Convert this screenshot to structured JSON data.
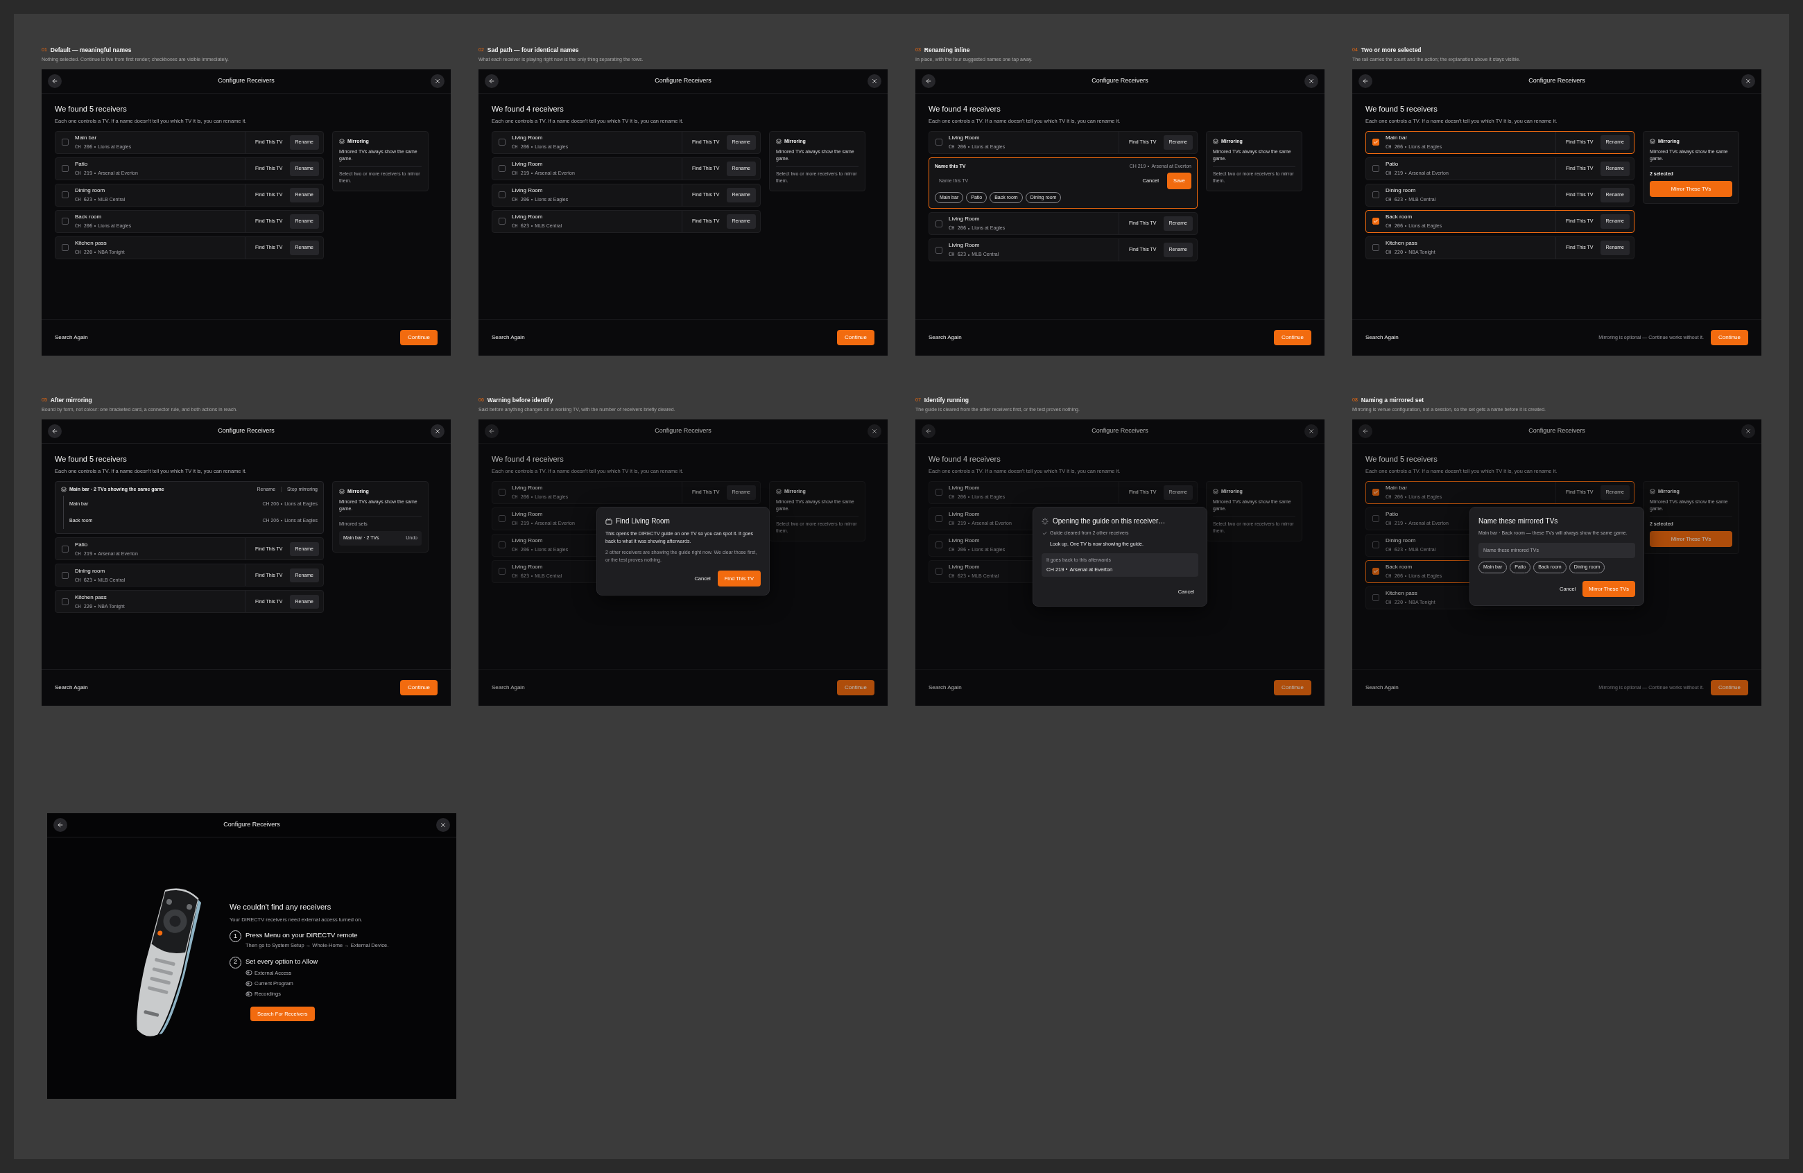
{
  "frames": [
    {
      "number": "01",
      "title": "Default — meaningful names",
      "caption": "Nothing selected. Continue is live from first render; checkboxes are visible immediately.",
      "dimmed": false,
      "screen": {
        "kind": "list",
        "title": "Configure Receivers",
        "heading": "We found 5 receivers",
        "subtext": "Each one controls a TV. If a name doesn't tell you which TV it is, you can rename it.",
        "receivers": [
          {
            "kind": "receiver",
            "name": "Main bar",
            "channel": "CH 206",
            "program": "Lions at Eagles",
            "checked": false,
            "find": "Find This TV",
            "rename": "Rename"
          },
          {
            "kind": "receiver",
            "name": "Patio",
            "channel": "CH 219",
            "program": "Arsenal at Everton",
            "checked": false,
            "find": "Find This TV",
            "rename": "Rename"
          },
          {
            "kind": "receiver",
            "name": "Dining room",
            "channel": "CH 623",
            "program": "MLB Central",
            "checked": false,
            "find": "Find This TV",
            "rename": "Rename"
          },
          {
            "kind": "receiver",
            "name": "Back room",
            "channel": "CH 206",
            "program": "Lions at Eagles",
            "checked": false,
            "find": "Find This TV",
            "rename": "Rename"
          },
          {
            "kind": "receiver",
            "name": "Kitchen pass",
            "channel": "CH 220",
            "program": "NBA Tonight",
            "checked": false,
            "find": "Find This TV",
            "rename": "Rename"
          }
        ],
        "rail": {
          "title": "Mirroring",
          "text": "Mirrored TVs always show the same game.",
          "hint": "Select two or more receivers to mirror them."
        },
        "footer": {
          "search": "Search Again",
          "continue": "Continue"
        }
      }
    },
    {
      "number": "02",
      "title": "Sad path — four identical names",
      "caption": "What each receiver is playing right now is the only thing separating the rows.",
      "dimmed": false,
      "screen": {
        "kind": "list",
        "title": "Configure Receivers",
        "heading": "We found 4 receivers",
        "subtext": "Each one controls a TV. If a name doesn't tell you which TV it is, you can rename it.",
        "receivers": [
          {
            "kind": "receiver",
            "name": "Living Room",
            "channel": "CH 206",
            "program": "Lions at Eagles",
            "checked": false,
            "find": "Find This TV",
            "rename": "Rename"
          },
          {
            "kind": "receiver",
            "name": "Living Room",
            "channel": "CH 219",
            "program": "Arsenal at Everton",
            "checked": false,
            "find": "Find This TV",
            "rename": "Rename"
          },
          {
            "kind": "receiver",
            "name": "Living Room",
            "channel": "CH 206",
            "program": "Lions at Eagles",
            "checked": false,
            "find": "Find This TV",
            "rename": "Rename"
          },
          {
            "kind": "receiver",
            "name": "Living Room",
            "channel": "CH 623",
            "program": "MLB Central",
            "checked": false,
            "find": "Find This TV",
            "rename": "Rename"
          }
        ],
        "rail": {
          "title": "Mirroring",
          "text": "Mirrored TVs always show the same game.",
          "hint": "Select two or more receivers to mirror them."
        },
        "footer": {
          "search": "Search Again",
          "continue": "Continue"
        }
      }
    },
    {
      "number": "03",
      "title": "Renaming inline",
      "caption": "In place, with the four suggested names one tap away.",
      "dimmed": false,
      "screen": {
        "kind": "list",
        "title": "Configure Receivers",
        "heading": "We found 4 receivers",
        "subtext": "Each one controls a TV. If a name doesn't tell you which TV it is, you can rename it.",
        "receivers": [
          {
            "kind": "receiver",
            "name": "Living Room",
            "channel": "CH 206",
            "program": "Lions at Eagles",
            "checked": false,
            "find": "Find This TV",
            "rename": "Rename"
          },
          {
            "kind": "editing",
            "label": "Name this TV",
            "channel": "CH 219",
            "program": "Arsenal at Everton",
            "placeholder": "Name this TV",
            "cancel": "Cancel",
            "save": "Save",
            "suggestions": [
              "Main bar",
              "Patio",
              "Back room",
              "Dining room"
            ]
          },
          {
            "kind": "receiver",
            "name": "Living Room",
            "channel": "CH 206",
            "program": "Lions at Eagles",
            "checked": false,
            "find": "Find This TV",
            "rename": "Rename"
          },
          {
            "kind": "receiver",
            "name": "Living Room",
            "channel": "CH 623",
            "program": "MLB Central",
            "checked": false,
            "find": "Find This TV",
            "rename": "Rename"
          }
        ],
        "rail": {
          "title": "Mirroring",
          "text": "Mirrored TVs always show the same game.",
          "hint": "Select two or more receivers to mirror them."
        },
        "footer": {
          "search": "Search Again",
          "continue": "Continue"
        }
      }
    },
    {
      "number": "04",
      "title": "Two or more selected",
      "caption": "The rail carries the count and the action; the explanation above it stays visible.",
      "dimmed": false,
      "screen": {
        "kind": "list",
        "title": "Configure Receivers",
        "heading": "We found 5 receivers",
        "subtext": "Each one controls a TV. If a name doesn't tell you which TV it is, you can rename it.",
        "receivers": [
          {
            "kind": "receiver",
            "name": "Main bar",
            "channel": "CH 206",
            "program": "Lions at Eagles",
            "checked": true,
            "find": "Find This TV",
            "rename": "Rename"
          },
          {
            "kind": "receiver",
            "name": "Patio",
            "channel": "CH 219",
            "program": "Arsenal at Everton",
            "checked": false,
            "find": "Find This TV",
            "rename": "Rename"
          },
          {
            "kind": "receiver",
            "name": "Dining room",
            "channel": "CH 623",
            "program": "MLB Central",
            "checked": false,
            "find": "Find This TV",
            "rename": "Rename"
          },
          {
            "kind": "receiver",
            "name": "Back room",
            "channel": "CH 206",
            "program": "Lions at Eagles",
            "checked": true,
            "find": "Find This TV",
            "rename": "Rename"
          },
          {
            "kind": "receiver",
            "name": "Kitchen pass",
            "channel": "CH 220",
            "program": "NBA Tonight",
            "checked": false,
            "find": "Find This TV",
            "rename": "Rename"
          }
        ],
        "rail": {
          "title": "Mirroring",
          "text": "Mirrored TVs always show the same game.",
          "selected_count": "2 selected",
          "mirror_button": "Mirror These TVs"
        },
        "footer": {
          "search": "Search Again",
          "note": "Mirroring is optional — Continue works without it.",
          "continue": "Continue"
        }
      }
    },
    {
      "number": "05",
      "title": "After mirroring",
      "caption": "Bound by form, not colour: one bracketed card, a connector rule, and both actions in reach.",
      "dimmed": false,
      "screen": {
        "kind": "list",
        "title": "Configure Receivers",
        "heading": "We found 5 receivers",
        "subtext": "Each one controls a TV. If a name doesn't tell you which TV it is, you can rename it.",
        "receivers": [
          {
            "kind": "mirrored_set",
            "title": "Main bar · 2 TVs showing the same game",
            "rename": "Rename",
            "stop": "Stop mirroring",
            "members": [
              {
                "name": "Main bar",
                "channel": "CH 206",
                "program": "Lions at Eagles"
              },
              {
                "name": "Back room",
                "channel": "CH 206",
                "program": "Lions at Eagles"
              }
            ]
          },
          {
            "kind": "receiver",
            "name": "Patio",
            "channel": "CH 219",
            "program": "Arsenal at Everton",
            "checked": false,
            "find": "Find This TV",
            "rename": "Rename"
          },
          {
            "kind": "receiver",
            "name": "Dining room",
            "channel": "CH 623",
            "program": "MLB Central",
            "checked": false,
            "find": "Find This TV",
            "rename": "Rename"
          },
          {
            "kind": "receiver",
            "name": "Kitchen pass",
            "channel": "CH 220",
            "program": "NBA Tonight",
            "checked": false,
            "find": "Find This TV",
            "rename": "Rename"
          }
        ],
        "rail": {
          "title": "Mirroring",
          "text": "Mirrored TVs always show the same game.",
          "sets_label": "Mirrored sets",
          "sets": [
            {
              "label": "Main bar · 2 TVs",
              "undo": "Undo"
            }
          ]
        },
        "footer": {
          "search": "Search Again",
          "continue": "Continue"
        }
      }
    },
    {
      "number": "06",
      "title": "Warning before identify",
      "caption": "Said before anything changes on a working TV, with the number of receivers briefly cleared.",
      "dimmed": true,
      "screen": {
        "kind": "list",
        "title": "Configure Receivers",
        "heading": "We found 4 receivers",
        "subtext": "Each one controls a TV. If a name doesn't tell you which TV it is, you can rename it.",
        "receivers": [
          {
            "kind": "receiver",
            "name": "Living Room",
            "channel": "CH 206",
            "program": "Lions at Eagles",
            "checked": false,
            "find": "Find This TV",
            "rename": "Rename"
          },
          {
            "kind": "receiver",
            "name": "Living Room",
            "channel": "CH 219",
            "program": "Arsenal at Everton",
            "checked": false
          },
          {
            "kind": "receiver",
            "name": "Living Room",
            "channel": "CH 206",
            "program": "Lions at Eagles",
            "checked": false
          },
          {
            "kind": "receiver",
            "name": "Living Room",
            "channel": "CH 623",
            "program": "MLB Central",
            "checked": false
          }
        ],
        "rail": {
          "title": "Mirroring",
          "text": "Mirrored TVs always show the same game.",
          "hint": "Select two or more receivers to mirror them."
        },
        "footer": {
          "search": "Search Again",
          "continue": "Continue"
        },
        "dialog": {
          "kind": "confirm",
          "title": "Find Living Room",
          "body": "This opens the DIRECTV guide on one TV so you can spot it. It goes back to what it was showing afterwards.",
          "note": "2 other receivers are showing the guide right now. We clear those first, or the test proves nothing.",
          "cancel": "Cancel",
          "confirm": "Find This TV"
        }
      }
    },
    {
      "number": "07",
      "title": "Identify running",
      "caption": "The guide is cleared from the other receivers first, or the test proves nothing.",
      "dimmed": true,
      "screen": {
        "kind": "list",
        "title": "Configure Receivers",
        "heading": "We found 4 receivers",
        "subtext": "Each one controls a TV. If a name doesn't tell you which TV it is, you can rename it.",
        "receivers": [
          {
            "kind": "receiver",
            "name": "Living Room",
            "channel": "CH 206",
            "program": "Lions at Eagles",
            "checked": false,
            "find": "Find This TV",
            "rename": "Rename"
          },
          {
            "kind": "receiver",
            "name": "Living Room",
            "channel": "CH 219",
            "program": "Arsenal at Everton",
            "checked": false
          },
          {
            "kind": "receiver",
            "name": "Living Room",
            "channel": "CH 206",
            "program": "Lions at Eagles",
            "checked": false
          },
          {
            "kind": "receiver",
            "name": "Living Room",
            "channel": "CH 623",
            "program": "MLB Central",
            "checked": false
          }
        ],
        "rail": {
          "title": "Mirroring",
          "text": "Mirrored TVs always show the same game.",
          "hint": "Select two or more receivers to mirror them."
        },
        "footer": {
          "search": "Search Again",
          "continue": "Continue"
        },
        "dialog": {
          "kind": "progress",
          "title": "Opening the guide on this receiver…",
          "steps": [
            {
              "text": "Guide cleared from 2 other receivers",
              "done": true
            },
            {
              "text": "Look up. One TV is now showing the guide.",
              "done": false
            }
          ],
          "box_label": "It goes back to this afterwards",
          "channel": "CH 219",
          "program": "Arsenal at Everton",
          "cancel": "Cancel"
        }
      }
    },
    {
      "number": "08",
      "title": "Naming a mirrored set",
      "caption": "Mirroring is venue configuration, not a session, so the set gets a name before it is created.",
      "dimmed": true,
      "screen": {
        "kind": "list",
        "title": "Configure Receivers",
        "heading": "We found 5 receivers",
        "subtext": "Each one controls a TV. If a name doesn't tell you which TV it is, you can rename it.",
        "receivers": [
          {
            "kind": "receiver",
            "name": "Main bar",
            "channel": "CH 206",
            "program": "Lions at Eagles",
            "checked": true,
            "find": "Find This TV",
            "rename": "Rename"
          },
          {
            "kind": "receiver",
            "name": "Patio",
            "channel": "CH 219",
            "program": "Arsenal at Everton",
            "checked": false
          },
          {
            "kind": "receiver",
            "name": "Dining room",
            "channel": "CH 623",
            "program": "MLB Central",
            "checked": false
          },
          {
            "kind": "receiver",
            "name": "Back room",
            "channel": "CH 206",
            "program": "Lions at Eagles",
            "checked": true
          },
          {
            "kind": "receiver",
            "name": "Kitchen pass",
            "channel": "CH 220",
            "program": "NBA Tonight",
            "checked": false
          }
        ],
        "rail": {
          "title": "Mirroring",
          "text": "Mirrored TVs always show the same game.",
          "selected_count": "2 selected",
          "mirror_button": "Mirror These TVs"
        },
        "footer": {
          "search": "Search Again",
          "note": "Mirroring is optional — Continue works without it.",
          "continue": "Continue"
        },
        "dialog": {
          "kind": "name",
          "title": "Name these mirrored TVs",
          "body": "Main bar · Back room — these TVs will always show the same game.",
          "placeholder": "Name these mirrored TVs",
          "suggestions": [
            "Main bar",
            "Patio",
            "Back room",
            "Dining room"
          ],
          "cancel": "Cancel",
          "confirm": "Mirror These TVs"
        }
      }
    }
  ],
  "empty_screen": {
    "kind": "empty",
    "title": "Configure Receivers",
    "heading": "We couldn't find any receivers",
    "subtext": "Your DIRECTV receivers need external access turned on.",
    "steps": [
      {
        "number": "1",
        "title": "Press Menu on your DIRECTV remote",
        "text": "Then go to System Setup → Whole-Home → External Device."
      },
      {
        "number": "2",
        "title": "Set every option to Allow",
        "options": [
          "External Access",
          "Current Program",
          "Recordings"
        ]
      }
    ],
    "button": "Search For Receivers"
  }
}
